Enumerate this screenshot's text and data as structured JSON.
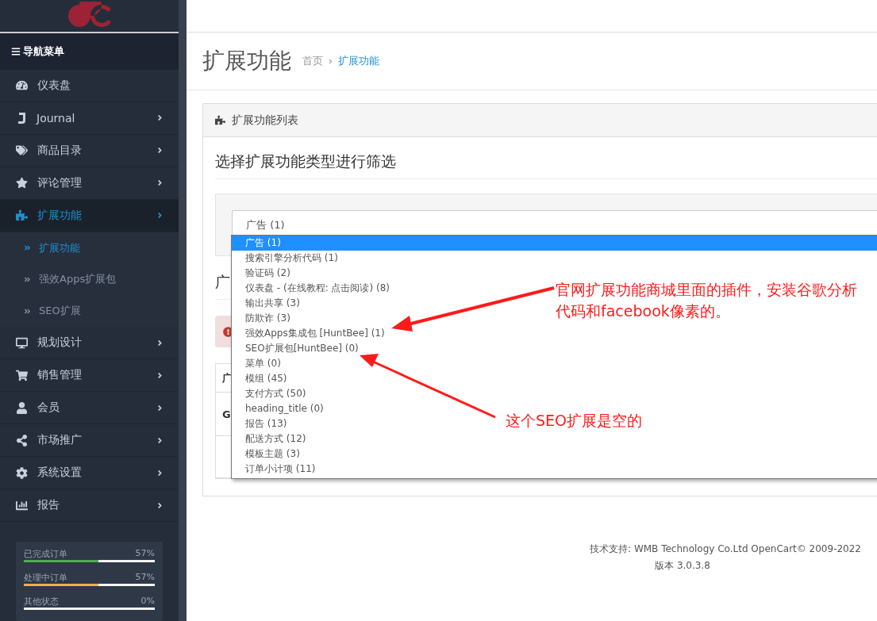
{
  "sidebar": {
    "header": "导航菜单",
    "items": [
      {
        "label": "仪表盘",
        "selected": false,
        "expandable": false
      },
      {
        "label": "Journal",
        "selected": false,
        "expandable": true
      },
      {
        "label": "商品目录",
        "selected": false,
        "expandable": true
      },
      {
        "label": "评论管理",
        "selected": false,
        "expandable": true
      },
      {
        "label": "扩展功能",
        "selected": true,
        "expandable": true,
        "children": [
          {
            "label": "扩展功能",
            "selected": true
          },
          {
            "label": "强效Apps扩展包",
            "selected": false
          },
          {
            "label": "SEO扩展",
            "selected": false
          }
        ]
      },
      {
        "label": "规划设计",
        "selected": false,
        "expandable": true
      },
      {
        "label": "销售管理",
        "selected": false,
        "expandable": true
      },
      {
        "label": "会员",
        "selected": false,
        "expandable": true
      },
      {
        "label": "市场推广",
        "selected": false,
        "expandable": true
      },
      {
        "label": "系统设置",
        "selected": false,
        "expandable": true
      },
      {
        "label": "报告",
        "selected": false,
        "expandable": true
      }
    ],
    "stats": [
      {
        "label": "已完成订单",
        "reading": "57%",
        "level": 0.57,
        "color": "#4cae4c"
      },
      {
        "label": "处理中订单",
        "reading": "57%",
        "level": 0.57,
        "color": "#f0ad4e"
      },
      {
        "label": "其他状态",
        "reading": "0%",
        "level": 0
      }
    ]
  },
  "page": {
    "title": "扩展功能",
    "breadcrumb": [
      "首页",
      "扩展功能"
    ]
  },
  "panel": {
    "title": "扩展功能列表",
    "filter_heading": "选择扩展功能类型进行筛选",
    "select": {
      "value": "广告 (1)",
      "expanded": true,
      "options": [
        {
          "label": "广告 (1)",
          "selected": true
        },
        {
          "label": "搜索引擎分析代码 (1)",
          "selected": false
        },
        {
          "label": "验证码 (2)",
          "selected": false
        },
        {
          "label": "仪表盘 - (在线教程: 点击阅读) (8)",
          "selected": false
        },
        {
          "label": "输出共享 (3)",
          "selected": false
        },
        {
          "label": "防欺诈 (3)",
          "selected": false
        },
        {
          "label": "强效Apps集成包 [HuntBee] (1)",
          "selected": false
        },
        {
          "label": "SEO扩展包[HuntBee] (0)",
          "selected": false
        },
        {
          "label": "菜单 (0)",
          "selected": false
        },
        {
          "label": "模组 (45)",
          "selected": false
        },
        {
          "label": "支付方式 (50)",
          "selected": false
        },
        {
          "label": "heading_title (0)",
          "selected": false
        },
        {
          "label": "报告 (13)",
          "selected": false
        },
        {
          "label": "配送方式 (12)",
          "selected": false
        },
        {
          "label": "模板主题 (3)",
          "selected": false
        },
        {
          "label": "订单小计项 (11)",
          "selected": false
        }
      ]
    },
    "section_heading": "广",
    "table": {
      "column_1": "广",
      "rows": [
        "G"
      ]
    }
  },
  "footer": {
    "credit": "技术支持: WMB Technology Co.Ltd  OpenCart© 2009-2022",
    "version": "版本 3.0.3.8"
  },
  "annotations": [
    "官网扩展功能商城里面的插件，安装谷歌分析代码和facebook像素的。",
    "这个SEO扩展是空的"
  ]
}
